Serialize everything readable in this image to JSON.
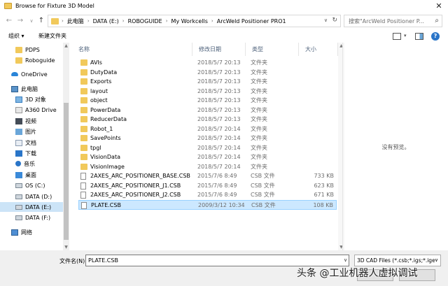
{
  "window": {
    "title": "Browse for Fixture 3D Model"
  },
  "nav": {
    "breadcrumb": [
      "此电脑",
      "DATA (E:)",
      "ROBOGUIDE",
      "My Workcells",
      "ArcWeld Positioner PRO1"
    ],
    "search_placeholder": "搜索\"ArcWeld Positioner P..."
  },
  "toolbar": {
    "organize": "组织 ▾",
    "new_folder": "新建文件夹"
  },
  "tree": [
    {
      "label": "PDPS",
      "icon": "folder-icon"
    },
    {
      "label": "Roboguide",
      "icon": "folder-icon"
    },
    {
      "label": "OneDrive",
      "icon": "cloud-icon"
    },
    {
      "label": "此电脑",
      "icon": "computer-icon"
    },
    {
      "label": "3D 对象",
      "icon": "3d-objects-icon"
    },
    {
      "label": "A360 Drive",
      "icon": "a360-icon"
    },
    {
      "label": "视频",
      "icon": "video-icon"
    },
    {
      "label": "图片",
      "icon": "pictures-icon"
    },
    {
      "label": "文档",
      "icon": "documents-icon"
    },
    {
      "label": "下载",
      "icon": "download-icon"
    },
    {
      "label": "音乐",
      "icon": "music-icon"
    },
    {
      "label": "桌面",
      "icon": "desktop-icon"
    },
    {
      "label": "OS (C:)",
      "icon": "drive-icon"
    },
    {
      "label": "DATA (D:)",
      "icon": "drive-icon"
    },
    {
      "label": "DATA (E:)",
      "icon": "drive-icon"
    },
    {
      "label": "DATA (F:)",
      "icon": "drive-icon"
    },
    {
      "label": "网络",
      "icon": "network-icon"
    }
  ],
  "columns": {
    "name": "名称",
    "date": "修改日期",
    "type": "类型",
    "size": "大小"
  },
  "files": [
    {
      "name": "AVIs",
      "date": "2018/5/7 20:13",
      "type": "文件夹",
      "size": "",
      "kind": "folder"
    },
    {
      "name": "DutyData",
      "date": "2018/5/7 20:13",
      "type": "文件夹",
      "size": "",
      "kind": "folder"
    },
    {
      "name": "Exports",
      "date": "2018/5/7 20:13",
      "type": "文件夹",
      "size": "",
      "kind": "folder"
    },
    {
      "name": "layout",
      "date": "2018/5/7 20:13",
      "type": "文件夹",
      "size": "",
      "kind": "folder"
    },
    {
      "name": "object",
      "date": "2018/5/7 20:13",
      "type": "文件夹",
      "size": "",
      "kind": "folder"
    },
    {
      "name": "PowerData",
      "date": "2018/5/7 20:13",
      "type": "文件夹",
      "size": "",
      "kind": "folder"
    },
    {
      "name": "ReducerData",
      "date": "2018/5/7 20:13",
      "type": "文件夹",
      "size": "",
      "kind": "folder"
    },
    {
      "name": "Robot_1",
      "date": "2018/5/7 20:14",
      "type": "文件夹",
      "size": "",
      "kind": "folder"
    },
    {
      "name": "SavePoints",
      "date": "2018/5/7 20:14",
      "type": "文件夹",
      "size": "",
      "kind": "folder"
    },
    {
      "name": "tpgl",
      "date": "2018/5/7 20:14",
      "type": "文件夹",
      "size": "",
      "kind": "folder"
    },
    {
      "name": "VisionData",
      "date": "2018/5/7 20:14",
      "type": "文件夹",
      "size": "",
      "kind": "folder"
    },
    {
      "name": "VisionImage",
      "date": "2018/5/7 20:14",
      "type": "文件夹",
      "size": "",
      "kind": "folder"
    },
    {
      "name": "2AXES_ARC_POSITIONER_BASE.CSB",
      "date": "2015/7/6 8:49",
      "type": "CSB 文件",
      "size": "733 KB",
      "kind": "file"
    },
    {
      "name": "2AXES_ARC_POSITIONER_J1.CSB",
      "date": "2015/7/6 8:49",
      "type": "CSB 文件",
      "size": "623 KB",
      "kind": "file"
    },
    {
      "name": "2AXES_ARC_POSITIONER_J2.CSB",
      "date": "2015/7/6 8:49",
      "type": "CSB 文件",
      "size": "671 KB",
      "kind": "file"
    },
    {
      "name": "PLATE.CSB",
      "date": "2009/3/12 10:34",
      "type": "CSB 文件",
      "size": "108 KB",
      "kind": "file"
    }
  ],
  "preview": {
    "message": "没有预览。"
  },
  "bottom": {
    "filename_label": "文件名(N):",
    "filename_value": "PLATE.CSB",
    "filetype_value": "3D CAD Files (*.csb;*.igs;*.ige"
  },
  "watermark": "头条 @工业机器人虚拟调试"
}
